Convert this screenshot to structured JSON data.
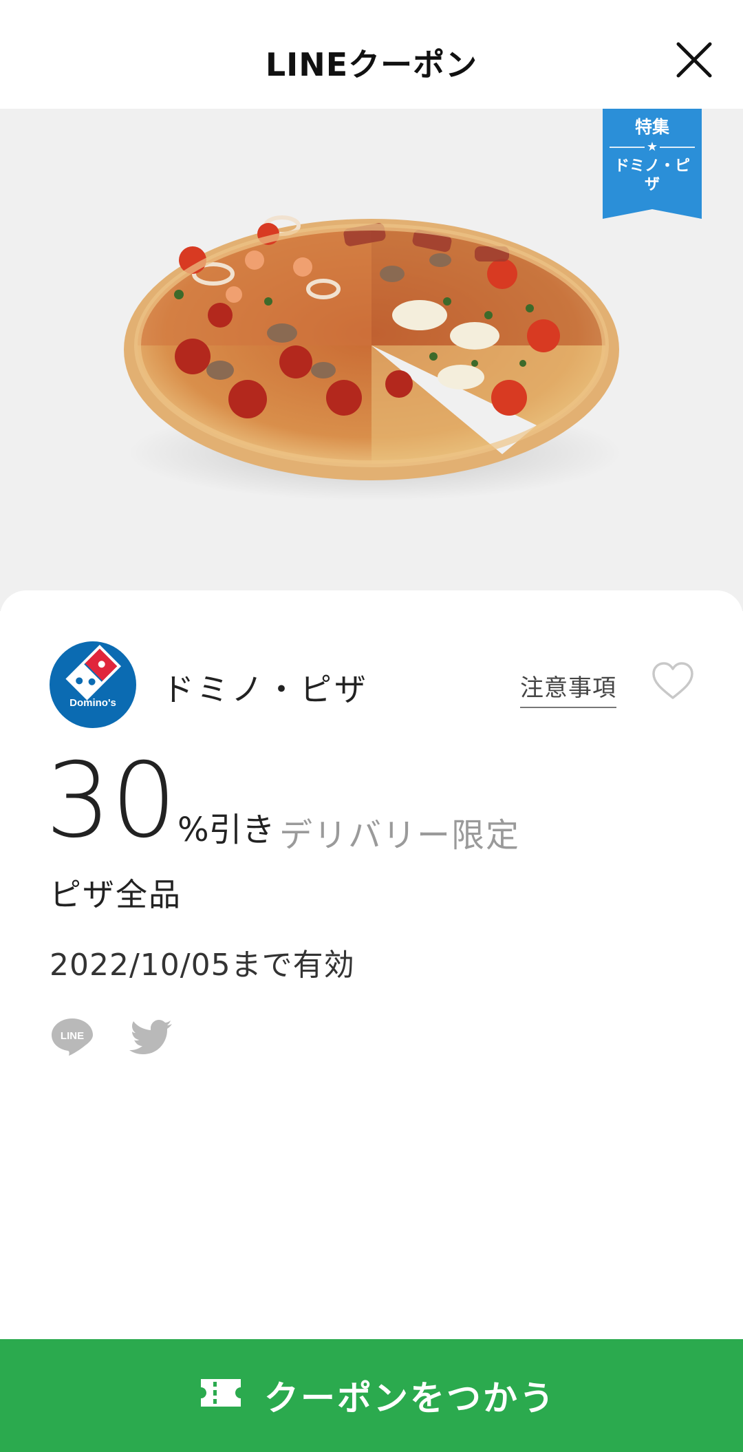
{
  "header": {
    "title": "LINEクーポン",
    "close_icon": "close-icon"
  },
  "hero": {
    "image": "pizza-photo",
    "ribbon": {
      "feature_label": "特集",
      "star": "★",
      "brand_label": "ドミノ・ピザ",
      "color": "#2b8fd8"
    }
  },
  "coupon": {
    "brand_logo_text": "Domino's",
    "brand_name": "ドミノ・ピザ",
    "notes_label": "注意事項",
    "favorite_icon": "heart-outline-icon",
    "discount_value": "30",
    "discount_unit": "%引き",
    "condition": "デリバリー限定",
    "target": "ピザ全品",
    "validity": "2022/10/05まで有効",
    "share": {
      "line_icon_label": "LINE",
      "twitter_icon": "twitter-icon"
    }
  },
  "action": {
    "use_label": "クーポンをつかう",
    "icon": "ticket-icon",
    "color": "#2baa4e"
  }
}
